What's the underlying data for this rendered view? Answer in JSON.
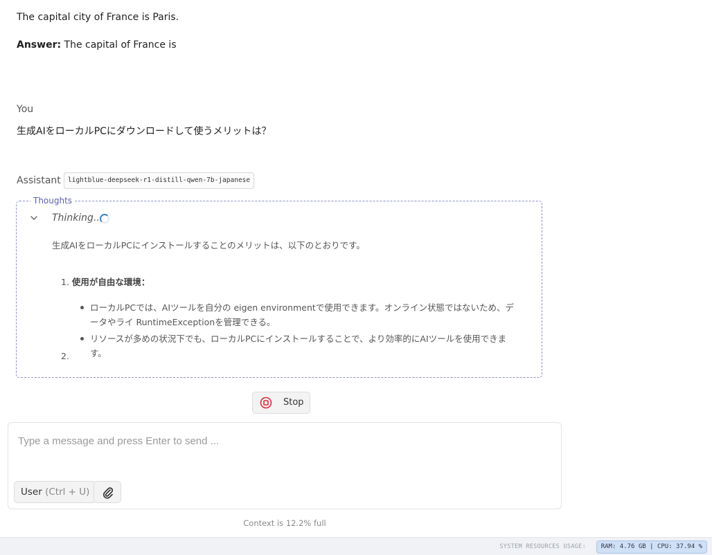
{
  "conversation": {
    "previous_line1": "The capital city of France is Paris.",
    "previous_answer_label": "Answer:",
    "previous_answer_text": " The capital of France is",
    "user_role_label": "You",
    "user_message": "生成AIをローカルPCにダウンロードして使うメリットは？",
    "assistant_role_label": "Assistant",
    "model_name": "lightblue-deepseek-r1-distill-qwen-7b-japanese"
  },
  "thoughts": {
    "legend": "Thoughts",
    "status": "Thinking...",
    "intro": "生成AIをローカルPCにインストールすることのメリットは、以下のとおりです。",
    "item1_number": "1.",
    "item1_title": "使用が自由な環境：",
    "bullets": [
      "ローカルPCでは、AIツールを自分の eigen environmentで使用できます。オンライン状態ではないため、データやライ RuntimeExceptionを管理できる。",
      "リソースが多めの状況下でも、ローカルPCにインストールすることで、より効率的にAIツールを使用できます。"
    ],
    "item2_number": "2."
  },
  "controls": {
    "stop_label": "Stop",
    "input_placeholder": "Type a message and press Enter to send ...",
    "input_value": "",
    "role_toggle_label": "User",
    "role_toggle_hint": "(Ctrl + U)"
  },
  "context_info": "Context is 12.2% full",
  "status_bar": {
    "caption": "SYSTEM RESOURCES USAGE:",
    "usage": "RAM: 4.76 GB  |  CPU: 37.94 %"
  },
  "colors": {
    "accent": "#5a5fa8",
    "stop_red": "#d32f3a",
    "status_pill_bg": "#cfe0f7"
  }
}
